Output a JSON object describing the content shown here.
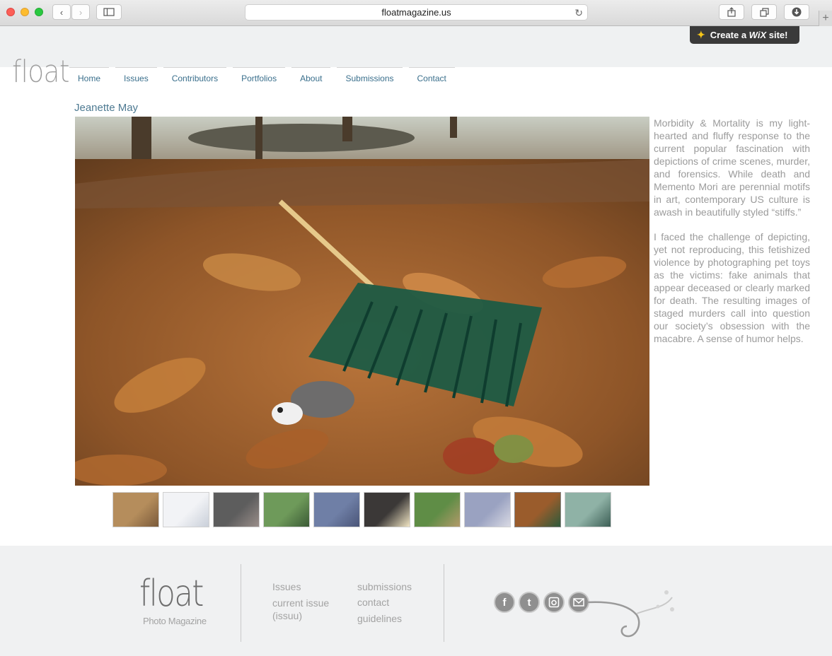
{
  "browser": {
    "url": "floatmagazine.us",
    "back_icon": "chevron-left",
    "forward_icon": "chevron-right",
    "sidebar_icon": "sidebar",
    "reload_icon": "reload",
    "share_icon": "share",
    "tabs_icon": "tabs",
    "download_icon": "download",
    "new_tab_label": "+"
  },
  "wix_banner": {
    "prefix": "Create a",
    "brand": "WiX",
    "suffix": "site!"
  },
  "site": {
    "logo": "float",
    "nav": [
      "Home",
      "Issues",
      "Contributors",
      "Portfolios",
      "About",
      "Submissions",
      "Contact"
    ]
  },
  "portfolio": {
    "artist": "Jeanette May",
    "description": [
      "Morbidity & Mortality is my light-hearted and fluffy response to the current popular fascination with depictions of crime scenes, murder, and forensics. While death and Memento Mori are perennial motifs in art, contemporary US culture is awash in beautifully styled “stiffs.”",
      "I faced the challenge of depicting, yet not reproducing, this fetishized violence by photographing pet toys as the victims: fake animals that appear deceased or clearly marked for death. The resulting images of staged murders call into question our society’s obsession with the macabre. A sense of humor helps."
    ],
    "thumbnails": [
      {
        "scene": "wooden-steps",
        "colors": [
          "#b58d5c",
          "#7a5a3a"
        ]
      },
      {
        "scene": "snow",
        "colors": [
          "#f2f3f6",
          "#c9cfd9"
        ]
      },
      {
        "scene": "sink",
        "colors": [
          "#5d5d5d",
          "#9a8e8a"
        ]
      },
      {
        "scene": "green-fence",
        "colors": [
          "#6e9a5a",
          "#3b5a35"
        ]
      },
      {
        "scene": "blue-ground",
        "colors": [
          "#6f7fa6",
          "#4a5578"
        ]
      },
      {
        "scene": "lamp-light",
        "colors": [
          "#3b3837",
          "#f2e6c4"
        ]
      },
      {
        "scene": "foliage",
        "colors": [
          "#5f8d46",
          "#b39a6a"
        ]
      },
      {
        "scene": "floor",
        "colors": [
          "#9aa2c1",
          "#d9dae4"
        ]
      },
      {
        "scene": "autumn-leaves-rake",
        "colors": [
          "#9a5c2c",
          "#2d5a3b"
        ]
      },
      {
        "scene": "water",
        "colors": [
          "#8fb2a6",
          "#3c5e55"
        ]
      }
    ],
    "active_thumbnail": 8
  },
  "footer": {
    "logo": "float",
    "tagline": "Photo Magazine",
    "col1": [
      "Issues",
      "current issue (issuu)"
    ],
    "col2": [
      "submissions",
      "contact",
      "guidelines"
    ],
    "social": [
      "facebook",
      "twitter",
      "instagram",
      "email"
    ]
  }
}
